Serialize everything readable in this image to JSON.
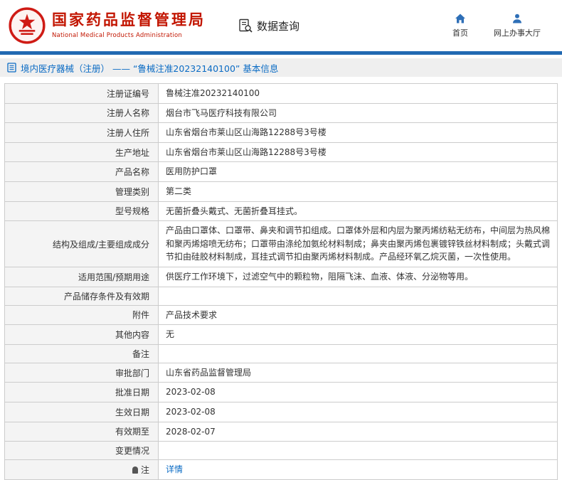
{
  "colors": {
    "brand_red": "#c21500",
    "accent_blue": "#2169b2",
    "link_blue": "#0a6bc4",
    "label_bg": "#f4f4f4",
    "border": "#cccccc"
  },
  "icons": {
    "brand": "nmpa-emblem",
    "data_query": "document-search-icon",
    "home": "home-icon",
    "hall": "user-icon",
    "breadcrumb": "document-icon",
    "note": "note-icon"
  },
  "header": {
    "org_name_cn": "国家药品监督管理局",
    "org_name_en": "National Medical Products Administration",
    "nav_data_query": "数据查询",
    "nav_home": "首页",
    "nav_hall": "网上办事大厅"
  },
  "breadcrumb": {
    "text": "境内医疗器械（注册） —— “鲁械注准20232140100” 基本信息"
  },
  "table": {
    "rows": [
      {
        "label": "注册证编号",
        "value": "鲁械注准20232140100"
      },
      {
        "label": "注册人名称",
        "value": "烟台市飞马医疗科技有限公司"
      },
      {
        "label": "注册人住所",
        "value": "山东省烟台市莱山区山海路12288号3号楼"
      },
      {
        "label": "生产地址",
        "value": "山东省烟台市莱山区山海路12288号3号楼"
      },
      {
        "label": "产品名称",
        "value": "医用防护口罩"
      },
      {
        "label": "管理类别",
        "value": "第二类"
      },
      {
        "label": "型号规格",
        "value": "无菌折叠头戴式、无菌折叠耳挂式。"
      },
      {
        "label": "结构及组成/主要组成成分",
        "value": "产品由口罩体、口罩带、鼻夹和调节扣组成。口罩体外层和内层为聚丙烯纺粘无纺布，中间层为热风棉和聚丙烯熔喷无纺布；口罩带由涤纶加氨纶材料制成；鼻夹由聚丙烯包裹镀锌铁丝材料制成；头戴式调节扣由硅胶材料制成，耳挂式调节扣由聚丙烯材料制成。产品经环氧乙烷灭菌，一次性使用。"
      },
      {
        "label": "适用范围/预期用途",
        "value": "供医疗工作环境下，过滤空气中的颗粒物，阻隔飞沫、血液、体液、分泌物等用。"
      },
      {
        "label": "产品储存条件及有效期",
        "value": ""
      },
      {
        "label": "附件",
        "value": "产品技术要求"
      },
      {
        "label": "其他内容",
        "value": "无"
      },
      {
        "label": "备注",
        "value": ""
      },
      {
        "label": "审批部门",
        "value": "山东省药品监督管理局"
      },
      {
        "label": "批准日期",
        "value": "2023-02-08"
      },
      {
        "label": "生效日期",
        "value": "2023-02-08"
      },
      {
        "label": "有效期至",
        "value": "2028-02-07"
      },
      {
        "label": "变更情况",
        "value": ""
      },
      {
        "label": "注",
        "value": "详情",
        "label_icon": "note-icon",
        "value_is_link": true
      }
    ]
  }
}
